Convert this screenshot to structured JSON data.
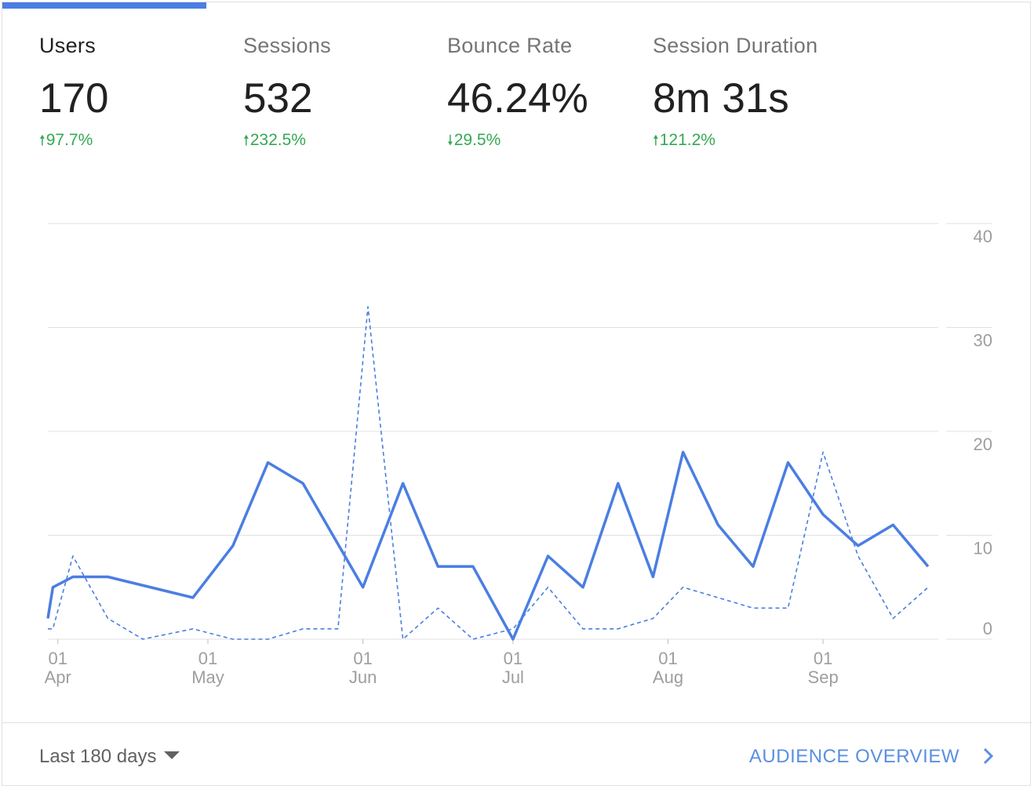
{
  "tabs": [
    {
      "label": "Users",
      "value": "170",
      "change": "97.7%",
      "direction": "up",
      "active": true
    },
    {
      "label": "Sessions",
      "value": "532",
      "change": "232.5%",
      "direction": "up",
      "active": false
    },
    {
      "label": "Bounce Rate",
      "value": "46.24%",
      "change": "29.5%",
      "direction": "down",
      "active": false
    },
    {
      "label": "Session Duration",
      "value": "8m 31s",
      "change": "121.2%",
      "direction": "up",
      "active": false
    }
  ],
  "footer": {
    "range_label": "Last 180 days",
    "link_label": "AUDIENCE OVERVIEW"
  },
  "colors": {
    "accent": "#4a7ee2",
    "positive": "#34a853",
    "link": "#5b8fe0",
    "grid": "#e0e0e0"
  },
  "chart_data": {
    "type": "line",
    "y_ticks": [
      "40",
      "30",
      "20",
      "10",
      "0"
    ],
    "ylim": [
      0,
      40
    ],
    "y_axis_position": "right",
    "grid": true,
    "legend": "none",
    "x_ticks": [
      {
        "date": "2019-04-01",
        "day": "01",
        "month": "Apr"
      },
      {
        "date": "2019-05-01",
        "day": "01",
        "month": "May"
      },
      {
        "date": "2019-06-01",
        "day": "01",
        "month": "Jun"
      },
      {
        "date": "2019-07-01",
        "day": "01",
        "month": "Jul"
      },
      {
        "date": "2019-08-01",
        "day": "01",
        "month": "Aug"
      },
      {
        "date": "2019-09-01",
        "day": "01",
        "month": "Sep"
      }
    ],
    "series": [
      {
        "style": "solid",
        "color": "#4a7ee2",
        "x": [
          "2019-03-30",
          "2019-03-31",
          "2019-04-04",
          "2019-04-11",
          "2019-04-28",
          "2019-05-06",
          "2019-05-13",
          "2019-05-20",
          "2019-06-01",
          "2019-06-09",
          "2019-06-16",
          "2019-06-23",
          "2019-07-01",
          "2019-07-08",
          "2019-07-15",
          "2019-07-22",
          "2019-07-29",
          "2019-08-04",
          "2019-08-11",
          "2019-08-18",
          "2019-08-25",
          "2019-09-01",
          "2019-09-08",
          "2019-09-15",
          "2019-09-22"
        ],
        "values": [
          2,
          5,
          6,
          6,
          4,
          9,
          17,
          15,
          5,
          15,
          7,
          7,
          0,
          8,
          5,
          15,
          6,
          18,
          11,
          7,
          17,
          12,
          9,
          11,
          7
        ]
      },
      {
        "style": "dashed",
        "color": "#4a7ee2",
        "x": [
          "2019-03-30",
          "2019-03-31",
          "2019-04-04",
          "2019-04-11",
          "2019-04-18",
          "2019-04-28",
          "2019-05-06",
          "2019-05-13",
          "2019-05-20",
          "2019-05-27",
          "2019-06-02",
          "2019-06-09",
          "2019-06-16",
          "2019-06-23",
          "2019-07-01",
          "2019-07-08",
          "2019-07-15",
          "2019-07-22",
          "2019-07-29",
          "2019-08-04",
          "2019-08-11",
          "2019-08-18",
          "2019-08-25",
          "2019-09-01",
          "2019-09-08",
          "2019-09-15",
          "2019-09-22"
        ],
        "values": [
          1,
          1,
          8,
          2,
          0,
          1,
          0,
          0,
          1,
          1,
          32,
          0,
          3,
          0,
          1,
          5,
          1,
          1,
          2,
          5,
          4,
          3,
          3,
          18,
          8,
          2,
          5
        ]
      }
    ]
  }
}
